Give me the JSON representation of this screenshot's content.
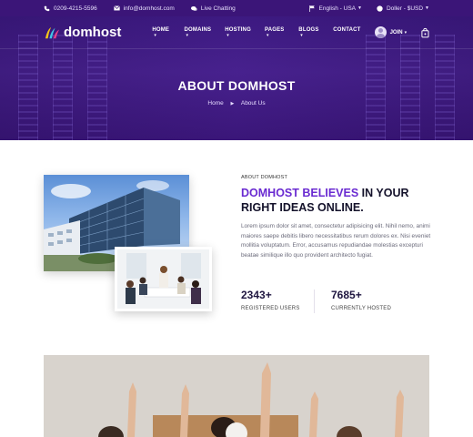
{
  "topbar": {
    "phone": "0209-4215-5596",
    "email": "info@domhost.com",
    "chat": "Live Chatting",
    "language": "English - USA",
    "currency": "Doller - $USD"
  },
  "brand": {
    "name": "domhost"
  },
  "nav": {
    "items": [
      "HOME",
      "DOMAINS",
      "HOSTING",
      "PAGES",
      "BLOGS",
      "CONTACT"
    ],
    "join": "JOIN"
  },
  "hero": {
    "title": "ABOUT DOMHOST",
    "breadcrumb": [
      "Home",
      "About Us"
    ]
  },
  "about": {
    "eyebrow": "ABOUT DOMHOST",
    "title_accent": "DOMHOST BELIEVES",
    "title_rest": " IN YOUR RIGHT IDEAS ONLINE.",
    "body": "Lorem ipsum dolor sit amet, consectetur adipisicing elit. Nihil nemo, animi maiores saepe debitis libero necessitatibus rerum dolores ex. Nisi eveniet mollitia voluptatum. Error, accusamus repudiandae molestias excepturi beatae similique illo quo provident architecto fugiat.",
    "stats": [
      {
        "value": "2343+",
        "label": "REGISTERED USERS"
      },
      {
        "value": "7685+",
        "label": "CURRENTLY HOSTED"
      }
    ]
  },
  "colors": {
    "topbar": "#3b1578",
    "hero": "#48228f",
    "accent": "#6a2bd1"
  },
  "icons": {
    "phone": "phone-icon",
    "email": "envelope-icon",
    "chat": "chat-bubble-icon",
    "language": "flag-icon",
    "currency": "coin-icon",
    "cart": "shopping-bag-icon"
  }
}
